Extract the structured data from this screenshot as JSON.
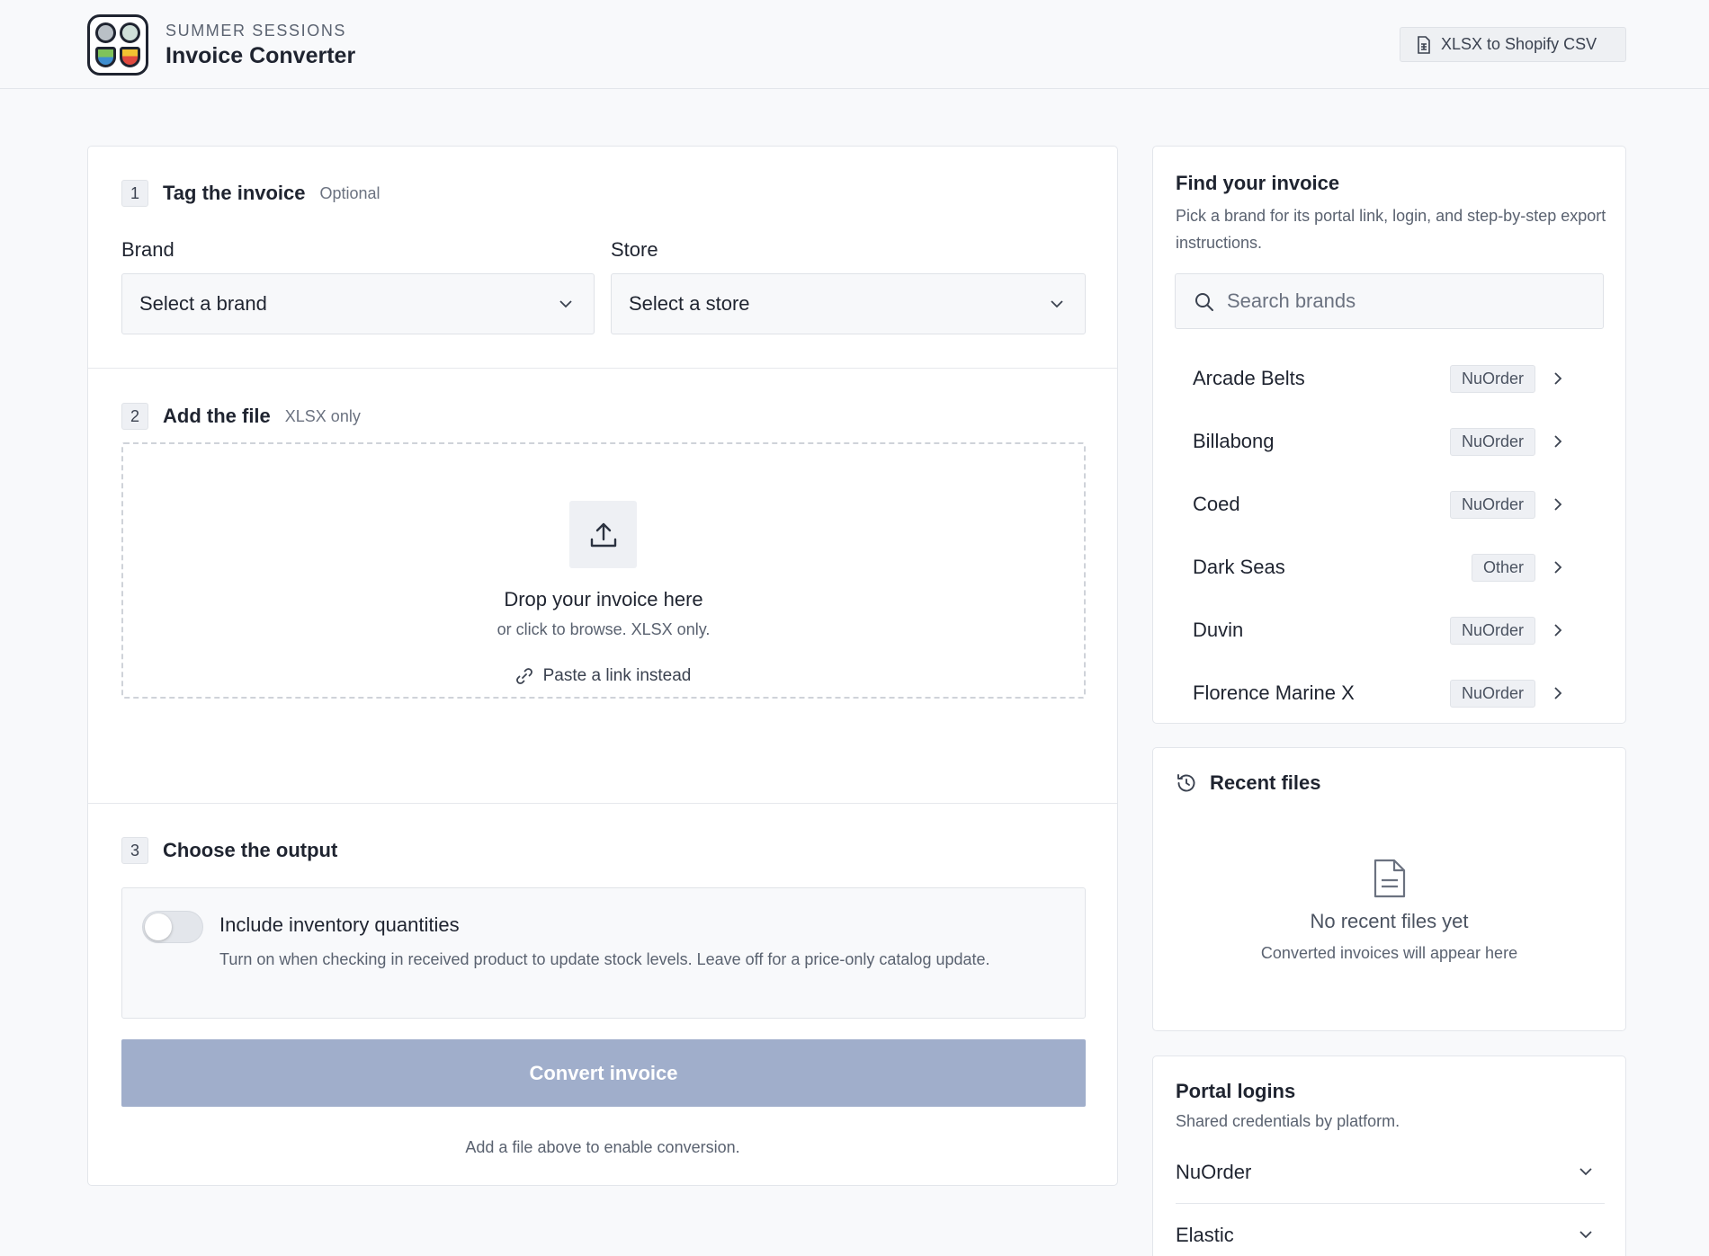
{
  "header": {
    "kicker": "SUMMER SESSIONS",
    "title": "Invoice Converter",
    "mode_label": "XLSX to Shopify CSV"
  },
  "steps": {
    "tag": {
      "number": "1",
      "title": "Tag the invoice",
      "subtitle": "Optional",
      "brand_label": "Brand",
      "brand_value": "Select a brand",
      "store_label": "Store",
      "store_value": "Select a store"
    },
    "file": {
      "number": "2",
      "title": "Add the file",
      "subtitle": "XLSX only",
      "drop_title": "Drop your invoice here",
      "drop_sub": "or click to browse. XLSX only.",
      "paste_link": "Paste a link instead"
    },
    "output": {
      "number": "3",
      "title": "Choose the output",
      "inventory_title": "Include inventory quantities",
      "inventory_desc": "Turn on when checking in received product to update stock levels. Leave off for a price-only catalog update.",
      "inventory_enabled": false,
      "convert_label": "Convert invoice",
      "convert_hint": "Add a file above to enable conversion."
    }
  },
  "find": {
    "title": "Find your invoice",
    "desc": "Pick a brand for its portal link, login, and step-by-step export instructions.",
    "search_placeholder": "Search brands",
    "brands": [
      {
        "name": "Arcade Belts",
        "platform": "NuOrder"
      },
      {
        "name": "Billabong",
        "platform": "NuOrder"
      },
      {
        "name": "Coed",
        "platform": "NuOrder"
      },
      {
        "name": "Dark Seas",
        "platform": "Other"
      },
      {
        "name": "Duvin",
        "platform": "NuOrder"
      },
      {
        "name": "Florence Marine X",
        "platform": "NuOrder"
      }
    ]
  },
  "recent": {
    "title": "Recent files",
    "empty_title": "No recent files yet",
    "empty_sub": "Converted invoices will appear here"
  },
  "portal": {
    "title": "Portal logins",
    "desc": "Shared credentials by platform.",
    "platforms": [
      "NuOrder",
      "Elastic"
    ]
  },
  "colors": {
    "accent_disabled": "#a0aecb",
    "background": "#f8f9fb"
  }
}
